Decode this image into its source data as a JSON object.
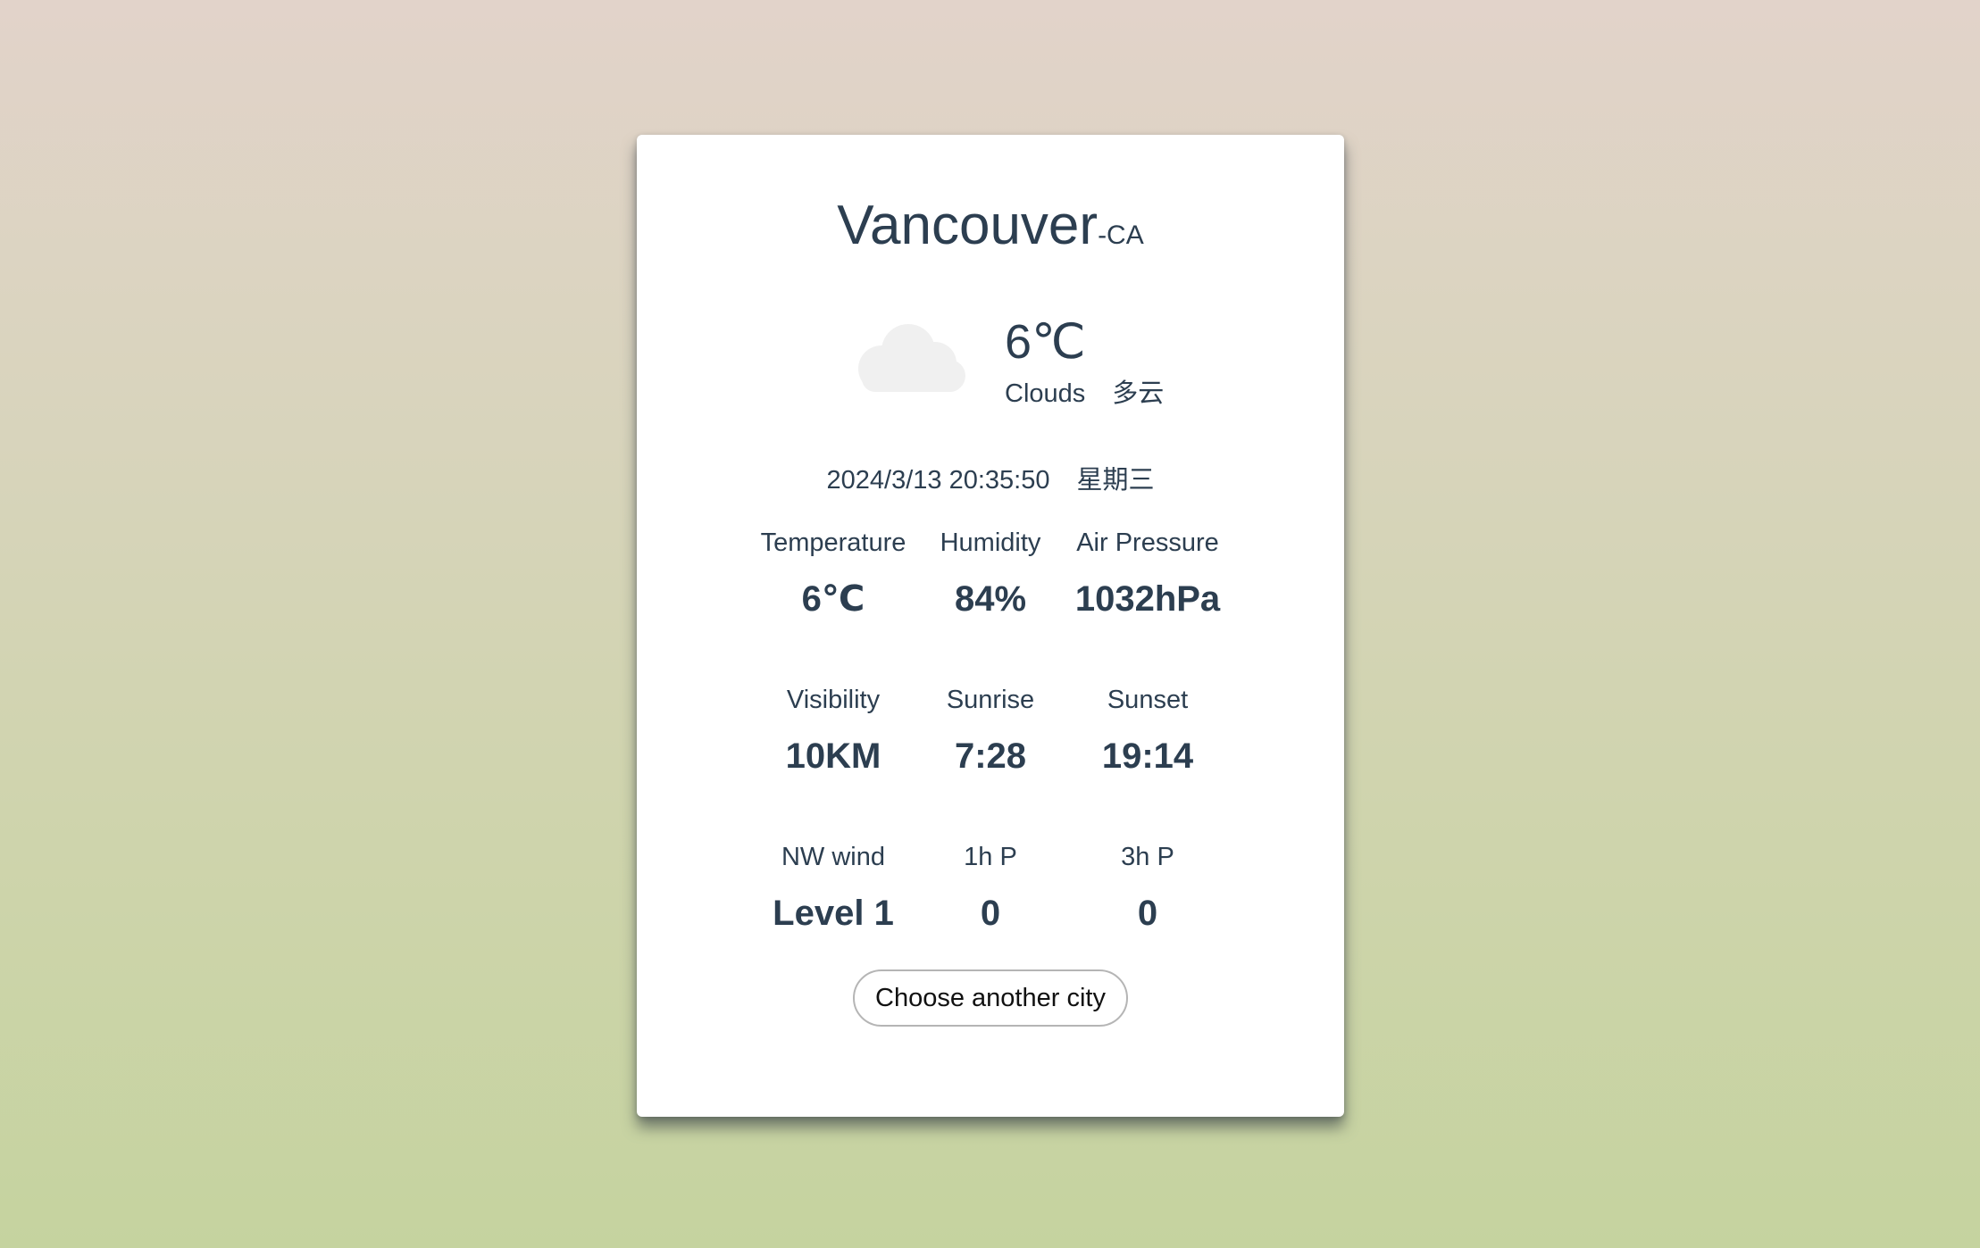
{
  "header": {
    "city": "Vancouver",
    "country": "-CA"
  },
  "current": {
    "icon": "cloud-icon",
    "temp": "6℃",
    "description_en": "Clouds",
    "description_zh": "多云"
  },
  "datetime": {
    "date_time": "2024/3/13 20:35:50",
    "weekday": "星期三"
  },
  "details": [
    {
      "label": "Temperature",
      "value": "6℃"
    },
    {
      "label": "Humidity",
      "value": "84%"
    },
    {
      "label": "Air Pressure",
      "value": "1032hPa"
    },
    {
      "label": "Visibility",
      "value": "10KM"
    },
    {
      "label": "Sunrise",
      "value": "7:28"
    },
    {
      "label": "Sunset",
      "value": "19:14"
    },
    {
      "label": "NW wind",
      "value": "Level 1"
    },
    {
      "label": "1h P",
      "value": "0"
    },
    {
      "label": "3h P",
      "value": "0"
    }
  ],
  "actions": {
    "choose_city_label": "Choose another city"
  },
  "colors": {
    "text": "#2c3e50",
    "card": "#ffffff",
    "cloud": "#f0f0f0"
  }
}
